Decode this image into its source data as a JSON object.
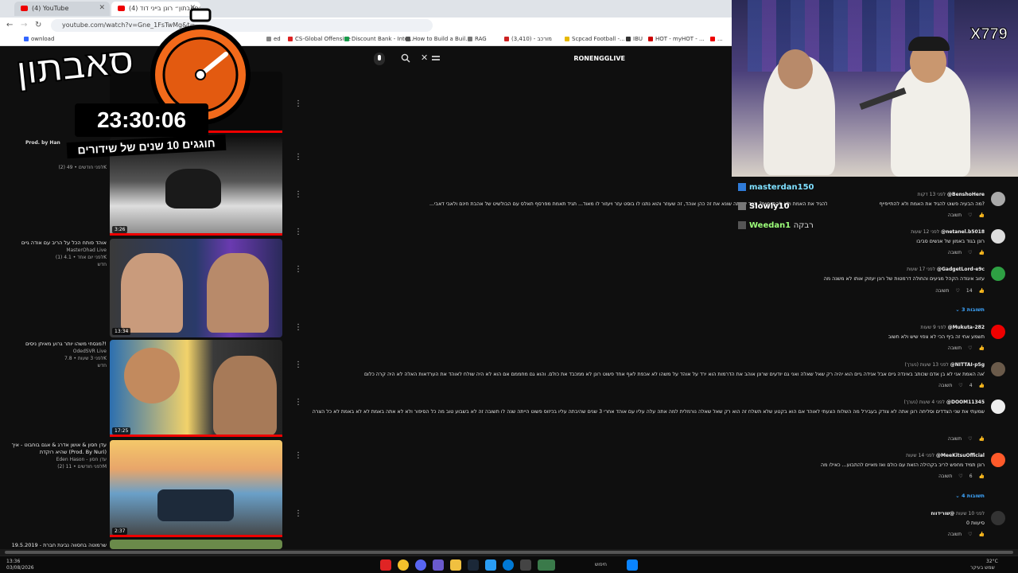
{
  "browser": {
    "tabs": [
      {
        "label": "(4) YouTube"
      },
      {
        "label": "(4) שידור ״סאבתון״ רונן בייני דוד"
      }
    ],
    "url": "youtube.com/watch?v=Gne_1FsTwMg&t=",
    "bookmarks": [
      "ownload",
      "ed",
      "CS-Global Offensive",
      "Discount Bank - Inte...",
      "How to Build a Buil...",
      "RAG",
      "(3,410) - מורכב",
      "Scpcad Football -...",
      "IBU",
      "HOT - myHOT - ...",
      "..."
    ]
  },
  "header": {
    "channel_name": "RONENGGLIVE"
  },
  "overlay": {
    "title": "סאבתון",
    "timer": "23:30:06",
    "subtitle": "חוגגים 10 שנים של שידורים"
  },
  "recommended": [
    {
      "title": "",
      "channel": "Prod. by Han",
      "meta": "",
      "duration": ""
    },
    {
      "title": "",
      "channel": "",
      "meta": "(2) לפני חודשים • 49K",
      "duration": "3:26"
    },
    {
      "title": "אוהד פותח הכל על הריב עם אודה גיים",
      "channel": "MasterOhad Live",
      "meta": "(1) לפני יום אחד • 4.1K",
      "badge": "חדש",
      "duration": "13:34"
    },
    {
      "title": "מנסחי משהו יותר גרוע מאיתן ניסים?!",
      "channel": "OdedSVR Live",
      "meta": "לפני 3 שעות • 7.8K",
      "badge": "חדש",
      "duration": "17:25"
    },
    {
      "title": "עדן חסון & אושן אדרג & אגם בוחבוט - איך שהיא רוקדת (Prod. By Nuri)",
      "channel": "Eden Hason - עדן חסון",
      "meta": "(2) לפני חודשים • 11M",
      "duration": "2:37"
    },
    {
      "title": "19.5.2019 - שרמוטה בחסווה נביגת חברת",
      "channel": "",
      "meta": "",
      "duration": ""
    }
  ],
  "long_comment_row": "...מה הבעיה פשוט להגיד את האמת ולא להתייפייף? תגיד שאתה שונא את זה כהן אוהד, זה שעוזר והוא נתנו לו בוסט עזר ויעזור לו מאוד... תגיד תאמת מפרסף תאלס עם הבולשיט של אהבת חינם ולאבי דאבי",
  "comments": [
    {
      "user": "@BenshoHere",
      "time": "לפני 13 דקות",
      "text": "מה הבעיה פשוט להגיד את האמת ולא להתייפייף?",
      "likes": "",
      "reply": "תשובה"
    },
    {
      "user": "@netanel.b5018",
      "time": "לפני 12 שעות",
      "text": "רונן בגוד באמון של אנשים סביבו",
      "likes": "",
      "reply": "תשובה"
    },
    {
      "user": "@GadgetLord-e9c",
      "time": "לפני 17 שעות",
      "text": "עזוב איגודה הקהל מגיעים והחולה דרמטות של רונן יעזוק אותו לא משנה מה",
      "likes": "14",
      "reply": "תשובה",
      "replies": "3 תשובות"
    },
    {
      "user": "@Mukuta-282",
      "time": "לפני 9 שעות",
      "text": "תשמע אחי זה ביף הכי לא צפוי שיש ולא חשוב",
      "likes": "",
      "reply": "תשובה"
    },
    {
      "user": "@NITTAI-p5g",
      "time": "לפני 13 שעות (נערך)",
      "text": "ולאה האמת אני לא בן אדם שכותב באינדה גיים אבל אנידה גיים הוא יהיה רק שאל שאלה ואני גם יודעים שרונן אוהב את הדרמות הוא ירד על אוהד על משהו לא אכפת לאף אחד פשוט רונן לא ממכבד את כולם. והוא גם מחממם אם הוא לא היה שולח לאוהד את הערדאות האלה לא היה קרה כלום",
      "likes": "4",
      "reply": "תשובה"
    },
    {
      "user": "@DOOM11345",
      "time": "לפני 4 שעות (נערך)",
      "text": "שמעתי את שני הצדדים וסליחה רונן אתה לא צודק בעבירל מה השלוח הצעתי לאוהד אם הוא בקטע שלא תשלח זה הוא רק שאל שאלה נורמלית למה אתה עלה עליו עם אוהד אחרי 3 שנים שהיבתה עליו בכיזוס פשוט הייתה שנה לו תשובה זה לא בשבוע טוב מה כל הסיפור ולא לא אתה באמת לא לא באמת לא כל הצרה",
      "likes": "",
      "reply": "תשובה"
    },
    {
      "user": "@MeeKitsuOfficial",
      "time": "לפני 14 שעות",
      "text": "רונן תמיד מחפש לריב בקהילה הזאת עם כולם ואז מאיים להתבוע... כאילו מה",
      "likes": "6",
      "reply": "תשובה",
      "replies": "4 תשובות"
    },
    {
      "user": "@שורידווח",
      "time": "לפני 10 שעות",
      "text": "0 סיעוות",
      "likes": "",
      "reply": "תשובה"
    }
  ],
  "chat": [
    {
      "name": "masterdan150",
      "color": "#7fe0ff",
      "text": ""
    },
    {
      "name": "Slowly10",
      "color": "#ffffff",
      "text": ""
    },
    {
      "name": "Weedan1",
      "color": "#9dff7a",
      "text": "רבקה"
    }
  ],
  "webcam": {
    "brand": "X779"
  },
  "taskbar": {
    "time": "13:36",
    "date": "03/08/2026",
    "search_label": "חיפוש",
    "weather": "32°C",
    "weather_desc": "שמש בעיקר"
  }
}
